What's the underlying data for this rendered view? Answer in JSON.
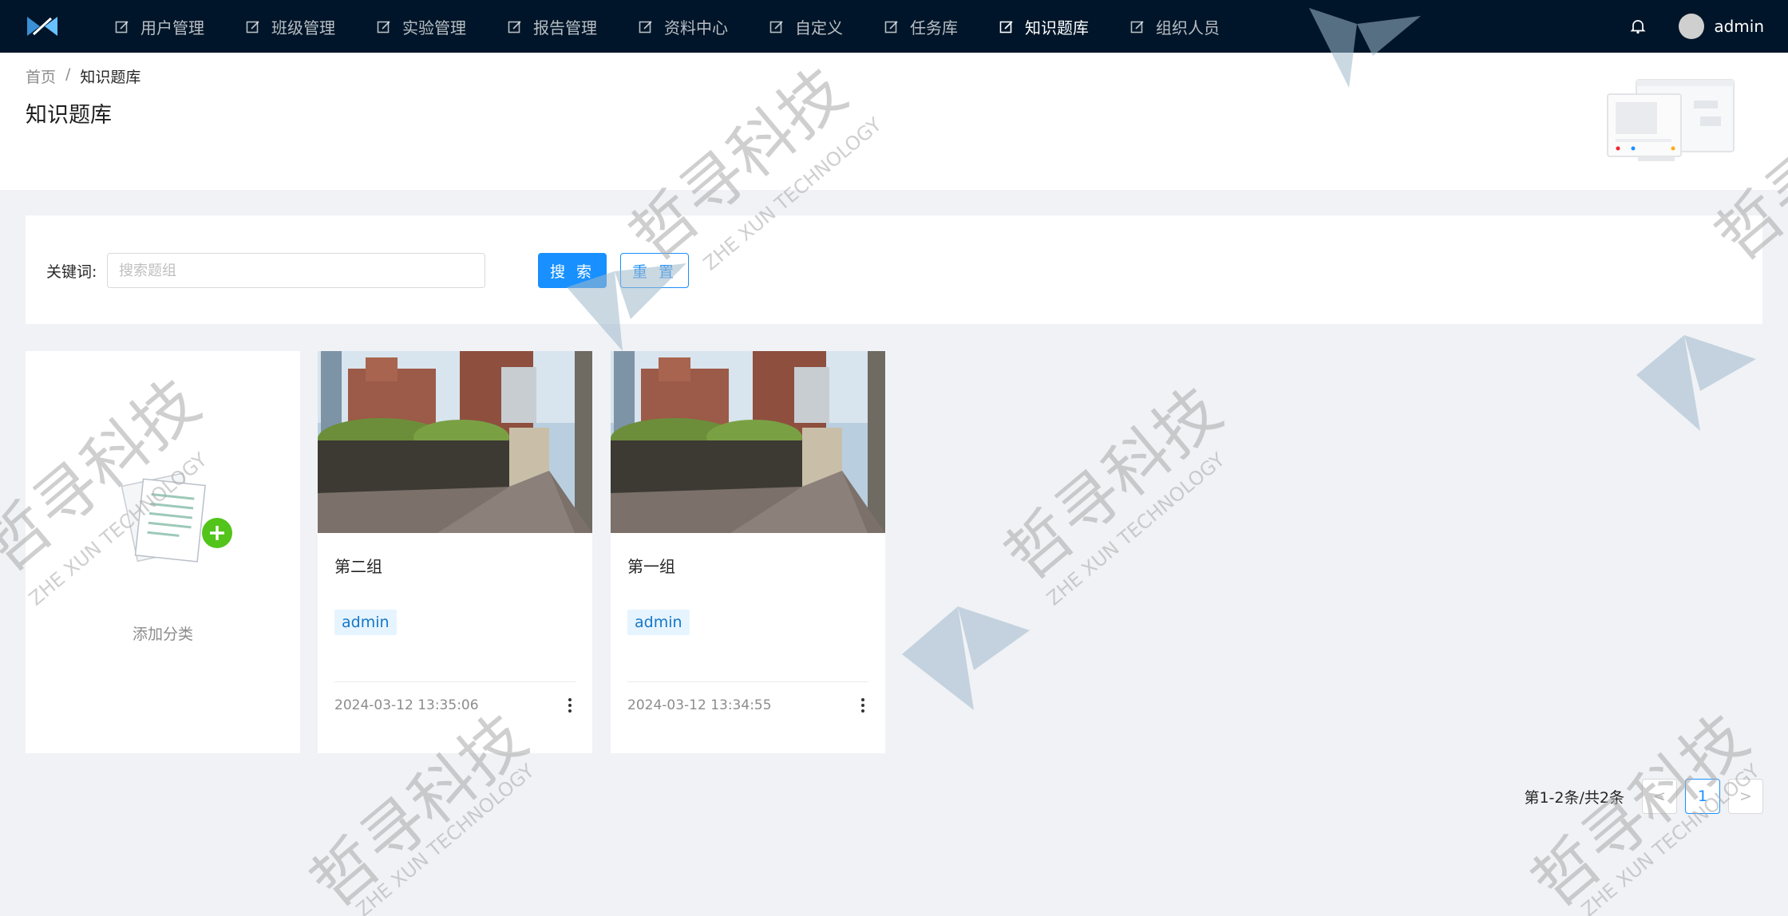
{
  "nav": {
    "items": [
      {
        "label": "用户管理",
        "active": false
      },
      {
        "label": "班级管理",
        "active": false
      },
      {
        "label": "实验管理",
        "active": false
      },
      {
        "label": "报告管理",
        "active": false
      },
      {
        "label": "资料中心",
        "active": false
      },
      {
        "label": "自定义",
        "active": false
      },
      {
        "label": "任务库",
        "active": false
      },
      {
        "label": "知识题库",
        "active": true
      },
      {
        "label": "组织人员",
        "active": false
      }
    ],
    "username": "admin"
  },
  "breadcrumb": {
    "home": "首页",
    "separator": "/",
    "current": "知识题库"
  },
  "page_title": "知识题库",
  "search": {
    "label": "关键词:",
    "placeholder": "搜索题组",
    "value": "",
    "search_label": "搜 索",
    "reset_label": "重 置"
  },
  "add_card": {
    "label": "添加分类"
  },
  "cards": [
    {
      "title": "第二组",
      "tag": "admin",
      "time": "2024-03-12 13:35:06"
    },
    {
      "title": "第一组",
      "tag": "admin",
      "time": "2024-03-12 13:34:55"
    }
  ],
  "pagination": {
    "total_text": "第1-2条/共2条",
    "current_page": "1",
    "prev": "<",
    "next": ">"
  },
  "watermark": {
    "cn": "哲寻科技",
    "en": "ZHE XUN TECHNOLOGY"
  },
  "colors": {
    "nav_bg": "#001529",
    "primary": "#1890ff",
    "tag_bg": "#e6f4ff",
    "add_green": "#52c41a"
  }
}
